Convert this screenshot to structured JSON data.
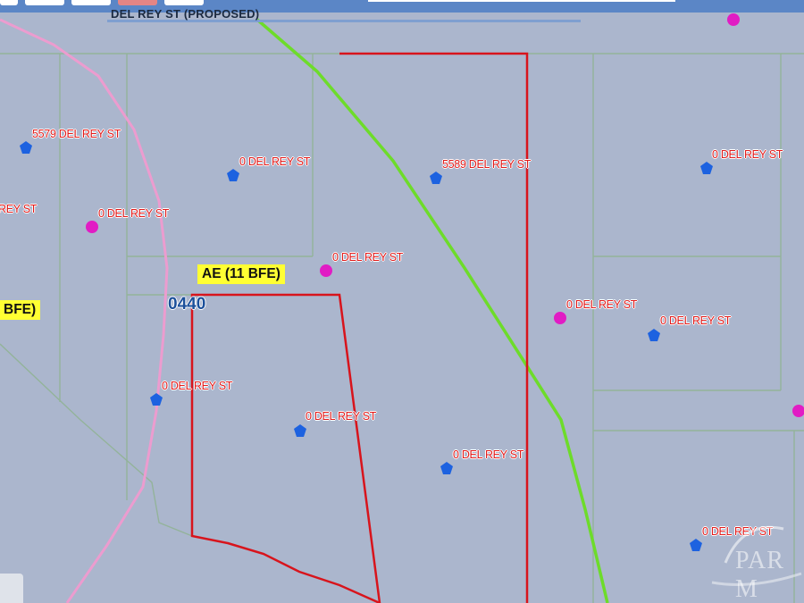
{
  "toolbar": {
    "street_label": "DEL REY ST (PROPOSED)"
  },
  "map": {
    "flood_zones": [
      {
        "id": "zone-main",
        "label": "AE (11 BFE)"
      },
      {
        "id": "zone-left",
        "label": "BFE)"
      }
    ],
    "panel_number": "0440",
    "addresses": [
      {
        "label": "5579 DEL REY ST",
        "marker": "blue"
      },
      {
        "label": "0 DEL REY ST",
        "marker": "blue"
      },
      {
        "label": "5589 DEL REY ST",
        "marker": "blue"
      },
      {
        "label": "0 DEL REY ST",
        "marker": "blue"
      },
      {
        "label": "0 DEL REY ST",
        "marker": "magenta"
      },
      {
        "label": "REY ST",
        "marker": "none"
      },
      {
        "label": "0 DEL REY ST",
        "marker": "magenta"
      },
      {
        "label": "0 DEL REY ST",
        "marker": "magenta"
      },
      {
        "label": "0 DEL REY ST",
        "marker": "blue"
      },
      {
        "label": "0 DEL REY ST",
        "marker": "blue"
      },
      {
        "label": "0 DEL REY ST",
        "marker": "blue"
      },
      {
        "label": "0 DEL REY ST",
        "marker": "blue"
      },
      {
        "label": "0 DEL REY ST",
        "marker": "blue"
      }
    ],
    "colors": {
      "background": "#abb6cd",
      "parcel_lines": "#93b39a",
      "highlighted_parcel": "#d8141c",
      "green_line": "#6ddc2a",
      "pink_line": "#ec9ccf",
      "blue_marker": "#1d62e0",
      "magenta_marker": "#e11cc4",
      "address_text": "#e01a1a",
      "zone_label_bg": "#ffff33",
      "toolbar": "#5b86c6"
    }
  },
  "watermark": {
    "text": "PAR M"
  }
}
